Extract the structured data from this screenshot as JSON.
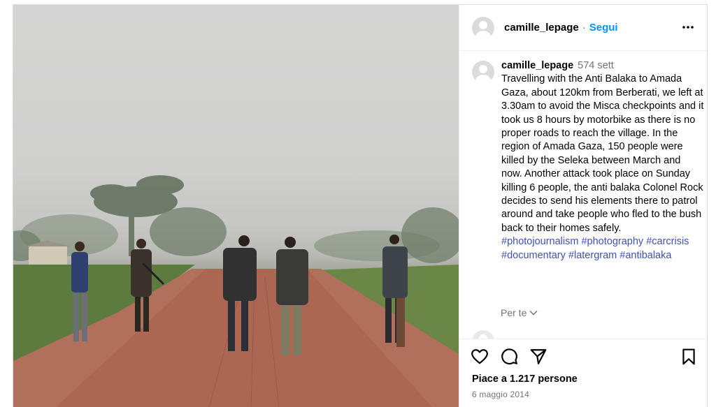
{
  "header": {
    "username": "camille_lepage",
    "separator": "·",
    "follow_label": "Segui",
    "more_icon": "more-horizontal-icon"
  },
  "caption": {
    "username": "camille_lepage",
    "time": "574 sett",
    "text": "Travelling with the Anti Balaka to Amada Gaza, about 120km from Berberati, we left at 3.30am to avoid the Misca checkpoints and it took us 8 hours by motorbike as there is no proper roads to reach the village. In the region of Amada Gaza, 150 people were killed by the Seleka between March and now. Another attack took place on Sunday killing 6 people, the anti balaka Colonel Rock decides to send his elements there to patrol around and take people who fled to the bush back to their homes safely.",
    "hashtags": [
      "#photojournalism",
      "#photography",
      "#carcrisis",
      "#documentary",
      "#latergram",
      "#antibalaka"
    ],
    "translate_label": "Per te"
  },
  "actions": {
    "icons": [
      "heart-icon",
      "comment-icon",
      "share-icon",
      "bookmark-icon"
    ],
    "likes_text": "Piace a 1.217 persone",
    "date_text": "6 maggio 2014"
  },
  "colors": {
    "link_blue": "#0095f6",
    "hashtag": "#3f51b5",
    "muted": "#737373",
    "border": "#dbdbdb"
  }
}
